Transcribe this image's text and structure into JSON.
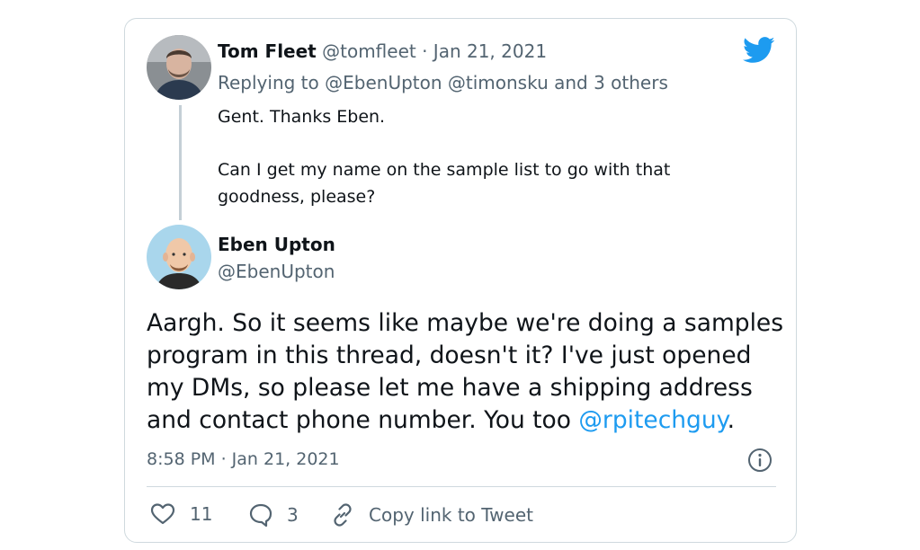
{
  "reply_tweet": {
    "author_name": "Tom Fleet",
    "author_handle": "@tomfleet",
    "separator": "·",
    "date": "Jan 21, 2021",
    "replying_prefix": "Replying to",
    "replying_mentions": "@EbenUpton @timonsku",
    "replying_suffix": "and 3 others",
    "text_line1": "Gent. Thanks Eben.",
    "text_line2": "Can I get my name on the sample list to go with that",
    "text_line3": "goodness, please?"
  },
  "main_tweet": {
    "author_name": "Eben Upton",
    "author_handle": "@EbenUpton",
    "text_line1": "Aargh. So it seems like maybe we're doing a samples",
    "text_line2": "program in this thread, doesn't it? I've just opened",
    "text_line3": "my DMs, so please let me have a shipping address",
    "text_line4_start": "and contact phone number. You too",
    "text_mention": "@rpitechguy",
    "text_line4_end": ".",
    "timestamp": "8:58 PM · Jan 21, 2021"
  },
  "actions": {
    "likes": "11",
    "replies": "3",
    "copy_link": "Copy link to Tweet"
  },
  "icons": {
    "brand": "twitter-bird-icon",
    "info": "info-icon",
    "like": "heart-icon",
    "reply": "speech-bubble-icon",
    "copy": "link-icon"
  },
  "colors": {
    "accent": "#1d9bf0",
    "text": "#0f1419",
    "muted": "#536471",
    "border": "#cfd9de"
  }
}
